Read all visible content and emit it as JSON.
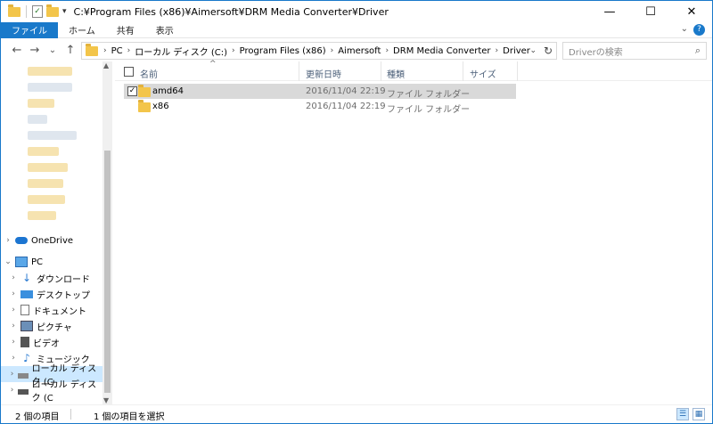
{
  "window": {
    "title": "C:¥Program Files (x86)¥Aimersoft¥DRM Media Converter¥Driver",
    "minimize": "—",
    "maximize": "☐",
    "close": "✕"
  },
  "ribbon": {
    "tabs": [
      "ファイル",
      "ホーム",
      "共有",
      "表示"
    ],
    "active_tab": "ファイル",
    "expand_glyph": "⌄",
    "help_glyph": "?"
  },
  "nav": {
    "back": "←",
    "forward": "→",
    "recent": "⌄",
    "up": "↑"
  },
  "address": {
    "crumbs": [
      "PC",
      "ローカル ディスク (C:)",
      "Program Files (x86)",
      "Aimersoft",
      "DRM Media Converter",
      "Driver"
    ],
    "chevron": "›",
    "refresh": "↻"
  },
  "search": {
    "placeholder": "Driverの検索"
  },
  "sidebar": {
    "items": [
      {
        "label": "OneDrive",
        "icon": "cloud-icon"
      },
      {
        "label": "PC",
        "icon": "computer-icon"
      },
      {
        "label": "ダウンロード",
        "icon": "download-icon"
      },
      {
        "label": "デスクトップ",
        "icon": "desktop-icon"
      },
      {
        "label": "ドキュメント",
        "icon": "document-icon"
      },
      {
        "label": "ピクチャ",
        "icon": "picture-icon"
      },
      {
        "label": "ビデオ",
        "icon": "video-icon"
      },
      {
        "label": "ミュージック",
        "icon": "music-icon"
      },
      {
        "label": "ローカル ディスク (C",
        "icon": "drive-icon"
      },
      {
        "label": "ローカル ディスク (C",
        "icon": "drive-icon"
      }
    ],
    "scroll_up": "▲",
    "scroll_down": "▼"
  },
  "columns": {
    "name": "名前",
    "date": "更新日時",
    "type": "種類",
    "size": "サイズ"
  },
  "files": [
    {
      "name": "amd64",
      "date": "2016/11/04 22:19",
      "type": "ファイル フォルダー",
      "checked": "✓"
    },
    {
      "name": "x86",
      "date": "2016/11/04 22:19",
      "type": "ファイル フォルダー"
    }
  ],
  "status": {
    "item_count": "2 個の項目",
    "selected": "1 個の項目を選択"
  },
  "view": {
    "details_glyph": "☰",
    "icons_glyph": "▦"
  },
  "colors": {
    "accent": "#1979ca",
    "folder": "#f3c54a",
    "selection": "#cce8ff"
  }
}
